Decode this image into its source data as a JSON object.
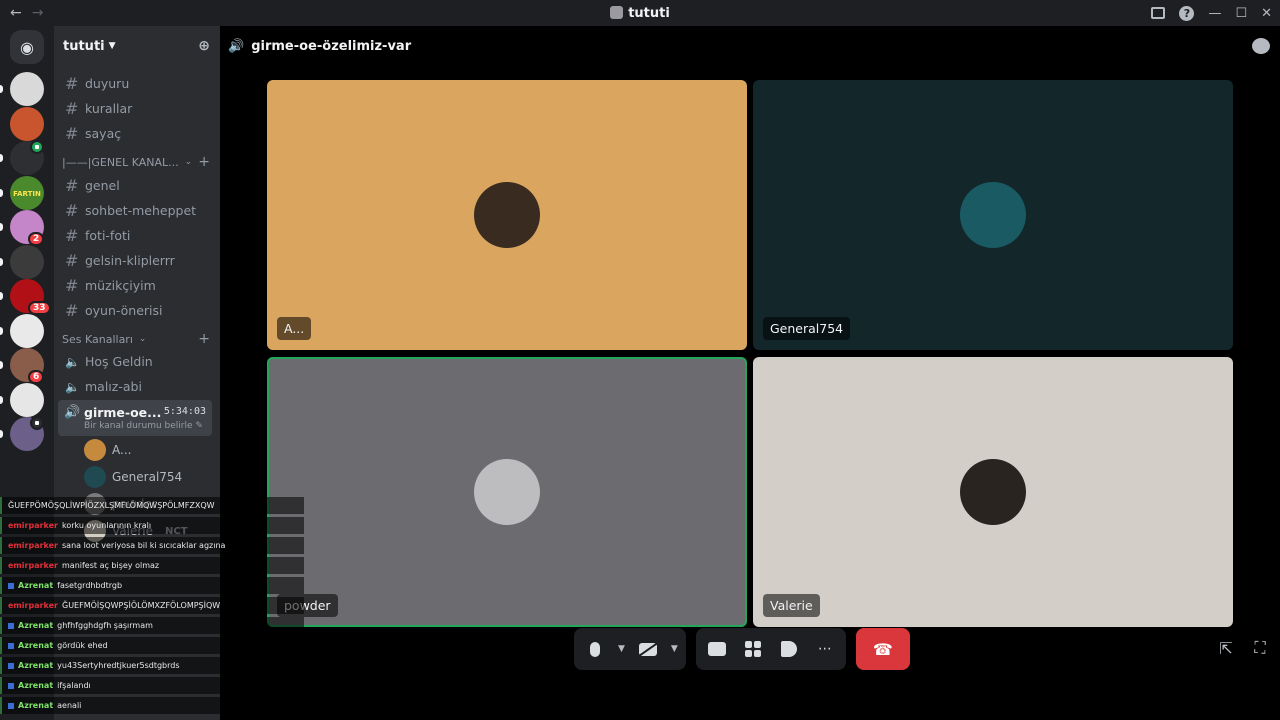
{
  "window": {
    "title": "tututi",
    "back": "←",
    "forward": "→",
    "help": "?"
  },
  "server": {
    "name": "tututi"
  },
  "guilds": [
    {
      "color": "#d9d9d9",
      "pill": true
    },
    {
      "color": "#c9552f",
      "pill": false
    },
    {
      "color": "#2e2f33",
      "pill": true,
      "speaker": true
    },
    {
      "color": "#4a8a2c",
      "pill": true,
      "label": "FARTIN"
    },
    {
      "color": "#c585c9",
      "pill": true,
      "badge": "2"
    },
    {
      "color": "#3b3b3b",
      "pill": true
    },
    {
      "color": "#b11116",
      "pill": true,
      "badge": "33"
    },
    {
      "color": "#e9e9e9",
      "pill": true
    },
    {
      "color": "#8a5c4a",
      "pill": true,
      "badge": "6"
    },
    {
      "color": "#e6e6e6",
      "pill": true
    },
    {
      "color": "#6c5f8a",
      "pill": true,
      "speaker": true
    }
  ],
  "text_channels": [
    "duyuru",
    "kurallar",
    "sayaç"
  ],
  "category_general": "|——|GENEL KANAL...",
  "general_channels": [
    "genel",
    "sohbet-meheppet",
    "foti-foti",
    "gelsin-kliplerrr",
    "müzikçiyim",
    "oyun-önerisi"
  ],
  "category_voice": "Ses Kanalları",
  "voice_channels": [
    "Hoş Geldin",
    "malız-abi"
  ],
  "active_voice": {
    "name": "girme-oe...",
    "timer": "5:34:03",
    "status": "Bir kanal durumu belirle"
  },
  "members": [
    {
      "name": "A...",
      "color": "#c58a3e"
    },
    {
      "name": "General754",
      "color": "#1f4a52"
    },
    {
      "name": "powder",
      "color": "#7b7b7b"
    },
    {
      "name": "Valerie",
      "color": "#d4cdc2",
      "tag": "NCT"
    }
  ],
  "channel_header": {
    "name": "girme-oe-özelimiz-var"
  },
  "tiles": [
    {
      "label": "A...",
      "bg": "#d9a55f",
      "av": "#3a2b20"
    },
    {
      "label": "General754",
      "bg": "#13262a",
      "av": "#1a5a63"
    },
    {
      "label": "powder",
      "bg": "#6c6c70",
      "av": "#bdbdc0"
    },
    {
      "label": "Valerie",
      "bg": "#d3cec7",
      "av": "#2a2420"
    }
  ],
  "chat": [
    {
      "user": "",
      "text": "ĞUEFPÖMÖŞQLİWPİÖZXLŞMFLÖMQWŞPÖLMFZXQW",
      "color": "green"
    },
    {
      "user": "emirparker",
      "text": "korku oyunlarının kralı",
      "color": "red"
    },
    {
      "user": "emirparker",
      "text": "sana loot veriyosa bil ki sıcıcaklar agzına",
      "color": "red"
    },
    {
      "user": "emirparker",
      "text": "manifest aç bişey olmaz",
      "color": "red"
    },
    {
      "user": "Azrenat",
      "text": "fasetgrdhbdtrgb",
      "color": "green"
    },
    {
      "user": "emirparker",
      "text": "ĞUEFMÖİŞQWPŞİÖLÖMXZFÖLOMPŞİQW",
      "color": "red"
    },
    {
      "user": "Azrenat",
      "text": "ghfhfgghdgfh şaşırmam",
      "color": "green"
    },
    {
      "user": "Azrenat",
      "text": "gördük ehed",
      "color": "green"
    },
    {
      "user": "Azrenat",
      "text": "yu43Sertyhredtjkuer5sdtgbrds",
      "color": "green"
    },
    {
      "user": "Azrenat",
      "text": "ifşalandı",
      "color": "green"
    },
    {
      "user": "Azrenat",
      "text": "aenali",
      "color": "green"
    }
  ]
}
